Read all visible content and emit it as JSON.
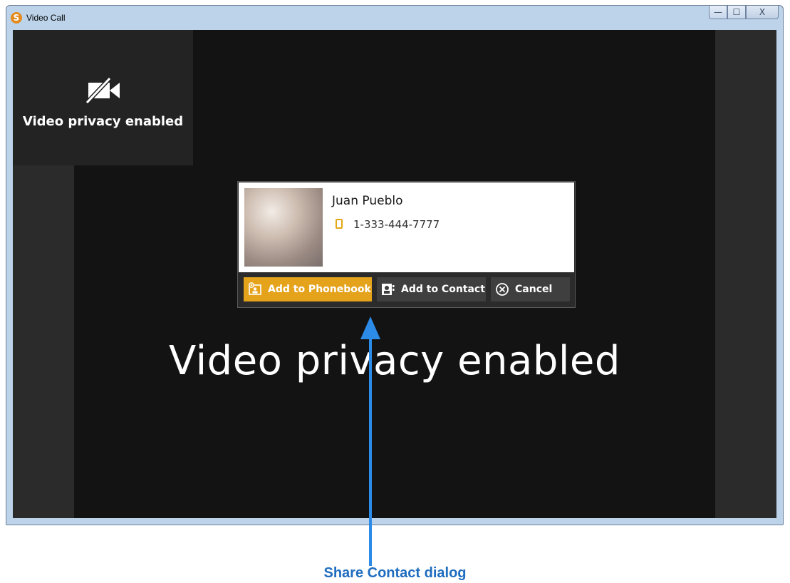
{
  "window": {
    "title": "Video Call",
    "app_icon_letter": "S",
    "controls": {
      "minimize": "—",
      "maximize": "☐",
      "close": "X"
    }
  },
  "self_view": {
    "status_text": "Video privacy enabled",
    "icon": "camera-off-icon"
  },
  "main_view": {
    "status_text": "Video privacy enabled"
  },
  "share_contact": {
    "name": "Juan Pueblo",
    "phone": "1-333-444-7777",
    "phone_icon": "mobile-phone-icon",
    "buttons": {
      "add_to_phonebook": "Add to Phonebook",
      "add_to_contact": "Add to Contact",
      "cancel": "Cancel"
    }
  },
  "annotation": {
    "caption": "Share Contact dialog",
    "color": "#2c8be6"
  },
  "colors": {
    "accent": "#e5a31c",
    "video_bg": "#131313",
    "panel": "#2b2b2b"
  }
}
